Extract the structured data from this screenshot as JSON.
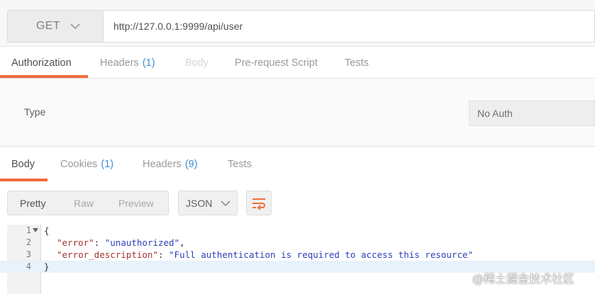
{
  "request": {
    "method": "GET",
    "url": "http://127.0.0.1:9999/api/user"
  },
  "request_tabs": [
    {
      "label": "Authorization",
      "count": "",
      "state": "active"
    },
    {
      "label": "Headers",
      "count": "(1)",
      "state": "normal"
    },
    {
      "label": "Body",
      "count": "",
      "state": "disabled"
    },
    {
      "label": "Pre-request Script",
      "count": "",
      "state": "normal"
    },
    {
      "label": "Tests",
      "count": "",
      "state": "normal"
    }
  ],
  "auth": {
    "type_label": "Type",
    "type_value": "No Auth"
  },
  "response_tabs": [
    {
      "label": "Body",
      "count": "",
      "state": "active"
    },
    {
      "label": "Cookies",
      "count": "(1)",
      "state": "normal"
    },
    {
      "label": "Headers",
      "count": "(9)",
      "state": "normal"
    },
    {
      "label": "Tests",
      "count": "",
      "state": "normal"
    }
  ],
  "response_toolbar": {
    "views": [
      "Pretty",
      "Raw",
      "Preview"
    ],
    "active_view": "Pretty",
    "format": "JSON",
    "wrap_icon": "wrap-lines-icon"
  },
  "code": {
    "lines": [
      {
        "number": "1",
        "open": "{"
      },
      {
        "number": "2",
        "key": "\"error\"",
        "sep": ": ",
        "value": "\"unauthorized\"",
        "end": ","
      },
      {
        "number": "3",
        "key": "\"error_description\"",
        "sep": ": ",
        "value": "\"Full authentication is required to access this resource\"",
        "end": ""
      },
      {
        "number": "4",
        "close": "}"
      }
    ]
  },
  "watermark": "@稀土掘金技术社区",
  "colors": {
    "accent": "#f26b3a",
    "count": "#3d8ed8",
    "json_key": "#a5332e",
    "json_string": "#2b3fb8"
  }
}
